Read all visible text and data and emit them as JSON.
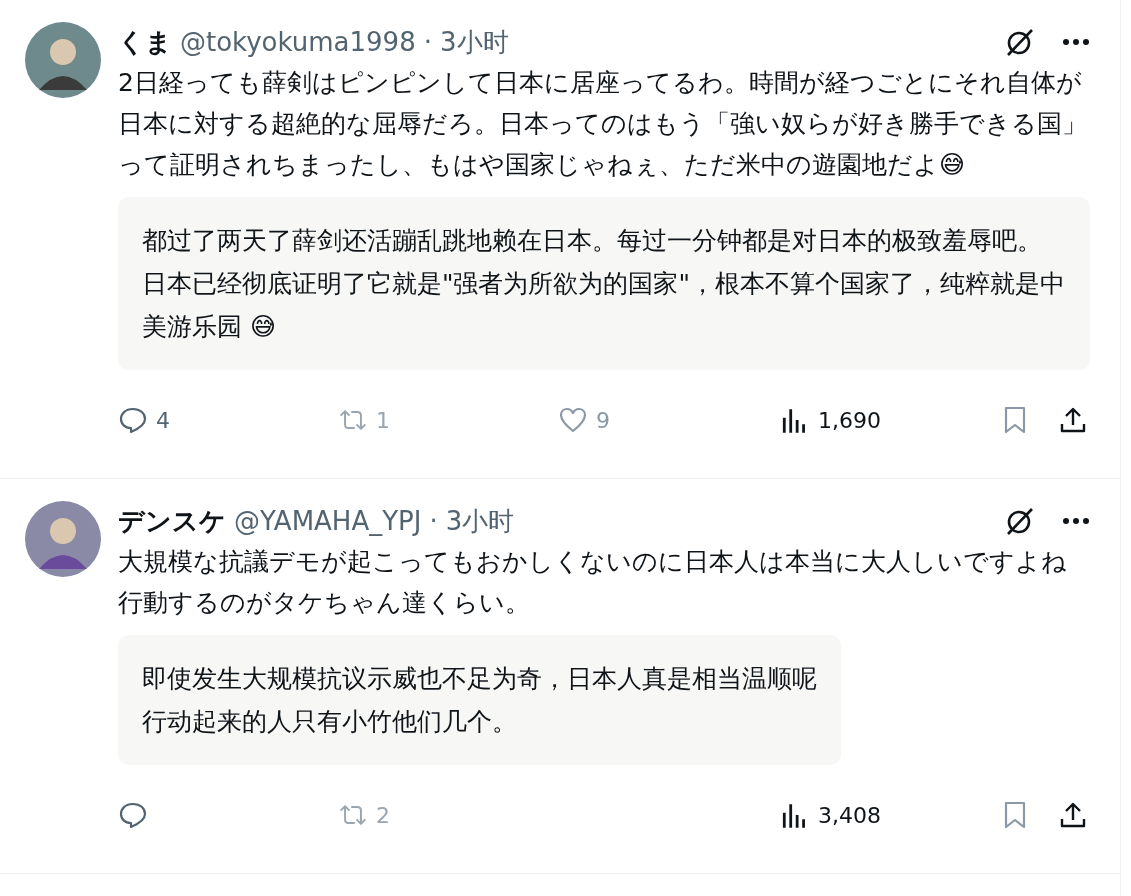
{
  "tweets": [
    {
      "name": "くま",
      "handle": "@tokyokuma1998",
      "separator": "·",
      "time": "3小时",
      "paragraphs": [
        "2日経っても薛剣はピンピンして日本に居座ってるわ。時間が経つごとにそれ自体が日本に対する超絶的な屈辱だろ。日本ってのはもう「強い奴らが好き勝手できる国」って証明されちまったし、もはや国家じゃねぇ、ただ米中の遊園地だよ😅"
      ],
      "translation": [
        "都过了两天了薛剑还活蹦乱跳地赖在日本。每过一分钟都是对日本的极致羞辱吧。日本已经彻底证明了它就是\"强者为所欲为的国家\"，根本不算个国家了，纯粹就是中美游乐园 😅"
      ],
      "actions": [
        {
          "kind": "reply",
          "count": "4"
        },
        {
          "kind": "retweet",
          "count": "1"
        },
        {
          "kind": "like",
          "count": "9"
        },
        {
          "kind": "views",
          "count": "1,690"
        },
        {
          "kind": "bookmark"
        },
        {
          "kind": "share"
        }
      ]
    },
    {
      "name": "デンスケ",
      "handle": "@YAMAHA_YPJ",
      "separator": "·",
      "time": "3小时",
      "paragraphs": [
        "大規模な抗議デモが起こってもおかしくないのに日本人は本当に大人しいですよね",
        "行動するのがタケちゃん達くらい。"
      ],
      "translation": [
        "即使发生大规模抗议示威也不足为奇，日本人真是相当温顺呢",
        "行动起来的人只有小竹他们几个。"
      ],
      "actions": [
        {
          "kind": "reply"
        },
        {
          "kind": "retweet",
          "count": "2"
        },
        {
          "kind": "views",
          "count": "3,408"
        },
        {
          "kind": "bookmark"
        },
        {
          "kind": "share"
        }
      ]
    }
  ]
}
